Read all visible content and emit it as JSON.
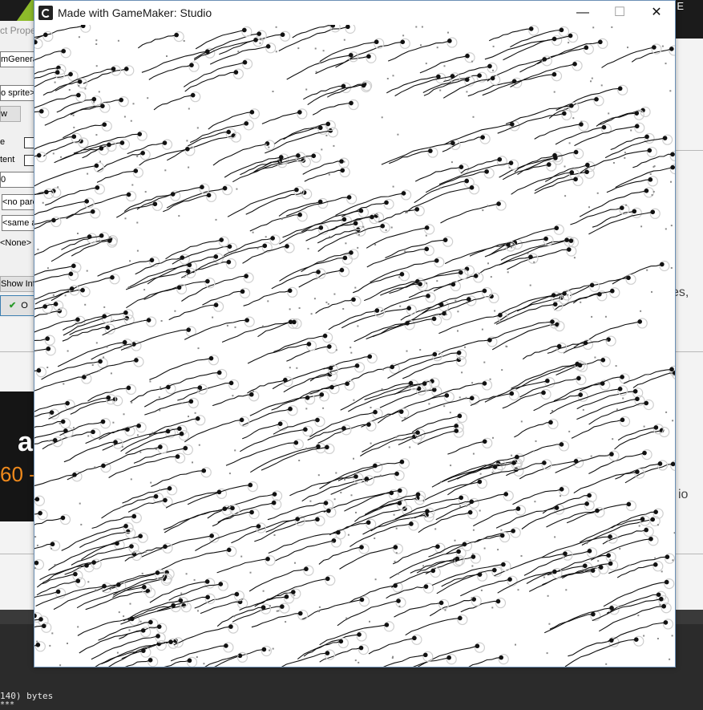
{
  "game_window": {
    "title": "Made with GameMaker: Studio",
    "controls": {
      "minimize": "—",
      "maximize": "☐",
      "close": "✕"
    }
  },
  "object_properties": {
    "title": "ct Prope",
    "name_field": "mGenerat",
    "sprite_field": "o sprite>",
    "new_button": "w",
    "visible_label": "e",
    "persistent_label": "tent",
    "depth_value": "0",
    "parent_field": "<no pare",
    "mask_field": "<same a",
    "physics_field": "<None>",
    "show_info_button": "Show Inf",
    "ok_button": "O"
  },
  "background": {
    "top_right_letter": "E",
    "right_text_1": "es,",
    "right_text_2": "io",
    "banner_letter": "a",
    "banner_price": "60 -",
    "console_line_1": "140) bytes",
    "console_line_2": "***"
  },
  "colors": {
    "titlebar_border": "#6b8fb5",
    "accent_green": "#8dbb2a",
    "banner_orange": "#f08a1c"
  },
  "icons": {
    "app_icon": "gamemaker-icon",
    "ok_icon": "checkmark-icon"
  }
}
